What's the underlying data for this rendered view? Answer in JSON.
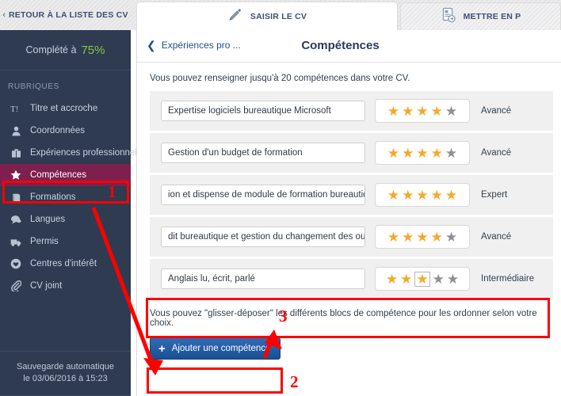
{
  "topbar": {
    "back_tab": {
      "label": "RETOUR À LA LISTE DES CV",
      "icon": "chevron-left-icon",
      "chevron": "‹"
    },
    "tabs": [
      {
        "label": "SAISIR LE CV",
        "icon": "pencil-icon",
        "active": true
      },
      {
        "label": "METTRE EN P",
        "icon": "document-export-icon",
        "active": false
      }
    ]
  },
  "sidebar": {
    "progress_label": "Complété à",
    "progress_value": "75%",
    "progress_color": "#8cc63f",
    "section_title": "RUBRIQUES",
    "items": [
      {
        "label": "Titre et accroche",
        "icon": "text-title-icon",
        "glyph": "T!",
        "active": false
      },
      {
        "label": "Coordonnées",
        "icon": "person-icon",
        "glyph": "♟",
        "active": false
      },
      {
        "label": "Expériences professionnelles",
        "icon": "briefcase-icon",
        "glyph": "▮",
        "active": false
      },
      {
        "label": "Compétences",
        "icon": "star-icon",
        "glyph": "★",
        "active": true
      },
      {
        "label": "Formations",
        "icon": "book-icon",
        "glyph": "▬",
        "active": false
      },
      {
        "label": "Langues",
        "icon": "speech-bubble-icon",
        "glyph": "●",
        "active": false
      },
      {
        "label": "Permis",
        "icon": "van-icon",
        "glyph": "▬",
        "active": false
      },
      {
        "label": "Centres d'intérêt",
        "icon": "heart-icon",
        "glyph": "♥",
        "active": false
      },
      {
        "label": "CV joint",
        "icon": "paperclip-icon",
        "glyph": "✂",
        "active": false
      }
    ],
    "autosave_line1": "Sauvegarde automatique",
    "autosave_line2": "le 03/06/2016 à 15:23"
  },
  "main": {
    "back_link": "Expériences pro ...",
    "title": "Compétences",
    "intro": "Vous pouvez renseigner jusqu'à 20 compétences dans votre CV.",
    "drag_note": "Vous pouvez \"glisser-déposer\" les différents blocs de compétence pour les ordonner selon votre choix.",
    "add_button": "Ajouter une compétence",
    "rows": [
      {
        "name": "Expertise logiciels bureautique Microsoft",
        "rating": 4,
        "level": "Avancé",
        "boxed_star": null
      },
      {
        "name": "Gestion d'un budget de formation",
        "rating": 4,
        "level": "Avancé",
        "boxed_star": null
      },
      {
        "name": "ion et dispense de module de formation bureautique",
        "rating": 5,
        "level": "Expert",
        "boxed_star": null
      },
      {
        "name": "dit bureautique et gestion du changement des outils",
        "rating": 4,
        "level": "Avancé",
        "boxed_star": null
      },
      {
        "name": "Anglais lu, écrit, parlé",
        "rating": 3,
        "level": "Intermédiaire",
        "boxed_star": 3
      }
    ]
  },
  "annotations": {
    "color": "#fe0000",
    "markers": [
      {
        "number": "1",
        "target": "sidebar-item-competences"
      },
      {
        "number": "2",
        "target": "add-competence-button"
      },
      {
        "number": "3",
        "target": "competence-row-5"
      }
    ]
  }
}
